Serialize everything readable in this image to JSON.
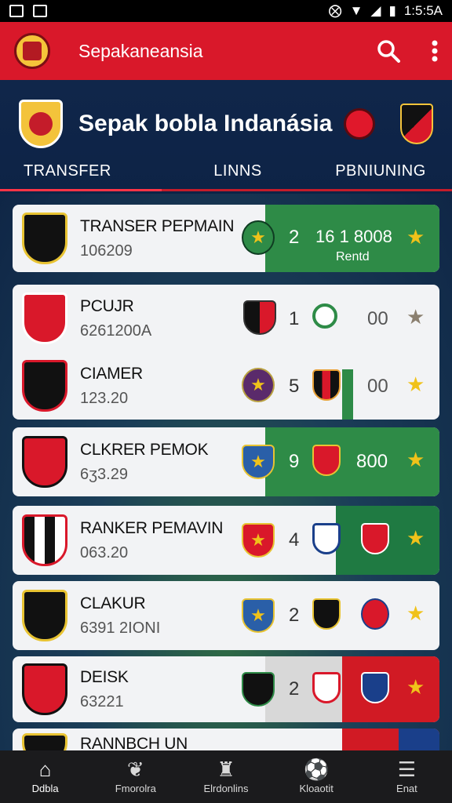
{
  "status_bar": {
    "time": "1:5:5A"
  },
  "app_bar": {
    "title": "Sepakaneansia"
  },
  "hero": {
    "title": "Sepak bobla Indanásia",
    "tabs": [
      "TRANSFER",
      "LINNS",
      "PBNIUNING"
    ]
  },
  "rows": [
    {
      "name": "TRANSER PEPMAIN",
      "sub": "106209",
      "num": "2",
      "score": "16 1 8008",
      "score_sub": "Rentd"
    },
    {
      "name": "PCUJR",
      "sub": "6261200A",
      "num": "1",
      "score": "00"
    },
    {
      "name": "CIAMER",
      "sub": "123.20",
      "num": "5",
      "score": "00"
    },
    {
      "name": "CLKRER PEMOK",
      "sub": "6ʒ3.29",
      "num": "9",
      "score": "800"
    },
    {
      "name": "RANKER PEMAVIN",
      "sub": "063.20",
      "num": "4"
    },
    {
      "name": "CLAKUR",
      "sub": "6391 2IONI",
      "num": "2"
    },
    {
      "name": "DEISK",
      "sub": "63221",
      "num": "2"
    },
    {
      "name": "RANNBCH UN",
      "sub": ""
    }
  ],
  "bottom_nav": [
    {
      "label": "Ddbla",
      "icon": "home-icon"
    },
    {
      "label": "Fmorolra",
      "icon": "leaf-icon"
    },
    {
      "label": "Elrdonlins",
      "icon": "trophy-icon"
    },
    {
      "label": "Kloaotit",
      "icon": "ball-badge-icon"
    },
    {
      "label": "Enat",
      "icon": "menu-icon"
    }
  ],
  "colors": {
    "brand_red": "#d9182a",
    "navy": "#0d2346",
    "green": "#2e8b47",
    "star": "#f0c21a"
  }
}
